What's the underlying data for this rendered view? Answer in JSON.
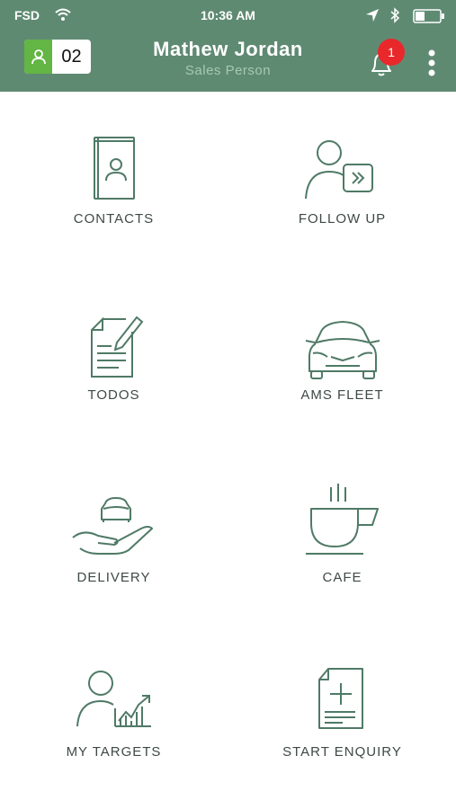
{
  "status_bar": {
    "carrier": "FSD",
    "time": "10:36 AM"
  },
  "header": {
    "counter_value": "02",
    "user_name": "Mathew Jordan",
    "user_role": "Sales Person",
    "notification_count": "1"
  },
  "colors": {
    "header_bg": "#5f8a72",
    "icon_stroke": "#4f7a66",
    "badge": "#e8282b",
    "counter_green": "#63b544"
  },
  "menu": {
    "contacts": {
      "label": "CONTACTS",
      "icon": "contact-book-icon"
    },
    "follow_up": {
      "label": "FOLLOW UP",
      "icon": "person-forward-icon"
    },
    "todos": {
      "label": "TODOS",
      "icon": "document-pencil-icon"
    },
    "ams_fleet": {
      "label": "AMS FLEET",
      "icon": "car-icon"
    },
    "delivery": {
      "label": "DELIVERY",
      "icon": "hand-car-icon"
    },
    "cafe": {
      "label": "CAFE",
      "icon": "coffee-cup-icon"
    },
    "my_targets": {
      "label": "MY TARGETS",
      "icon": "person-chart-icon"
    },
    "start_enquiry": {
      "label": "START ENQUIRY",
      "icon": "document-plus-icon"
    }
  }
}
